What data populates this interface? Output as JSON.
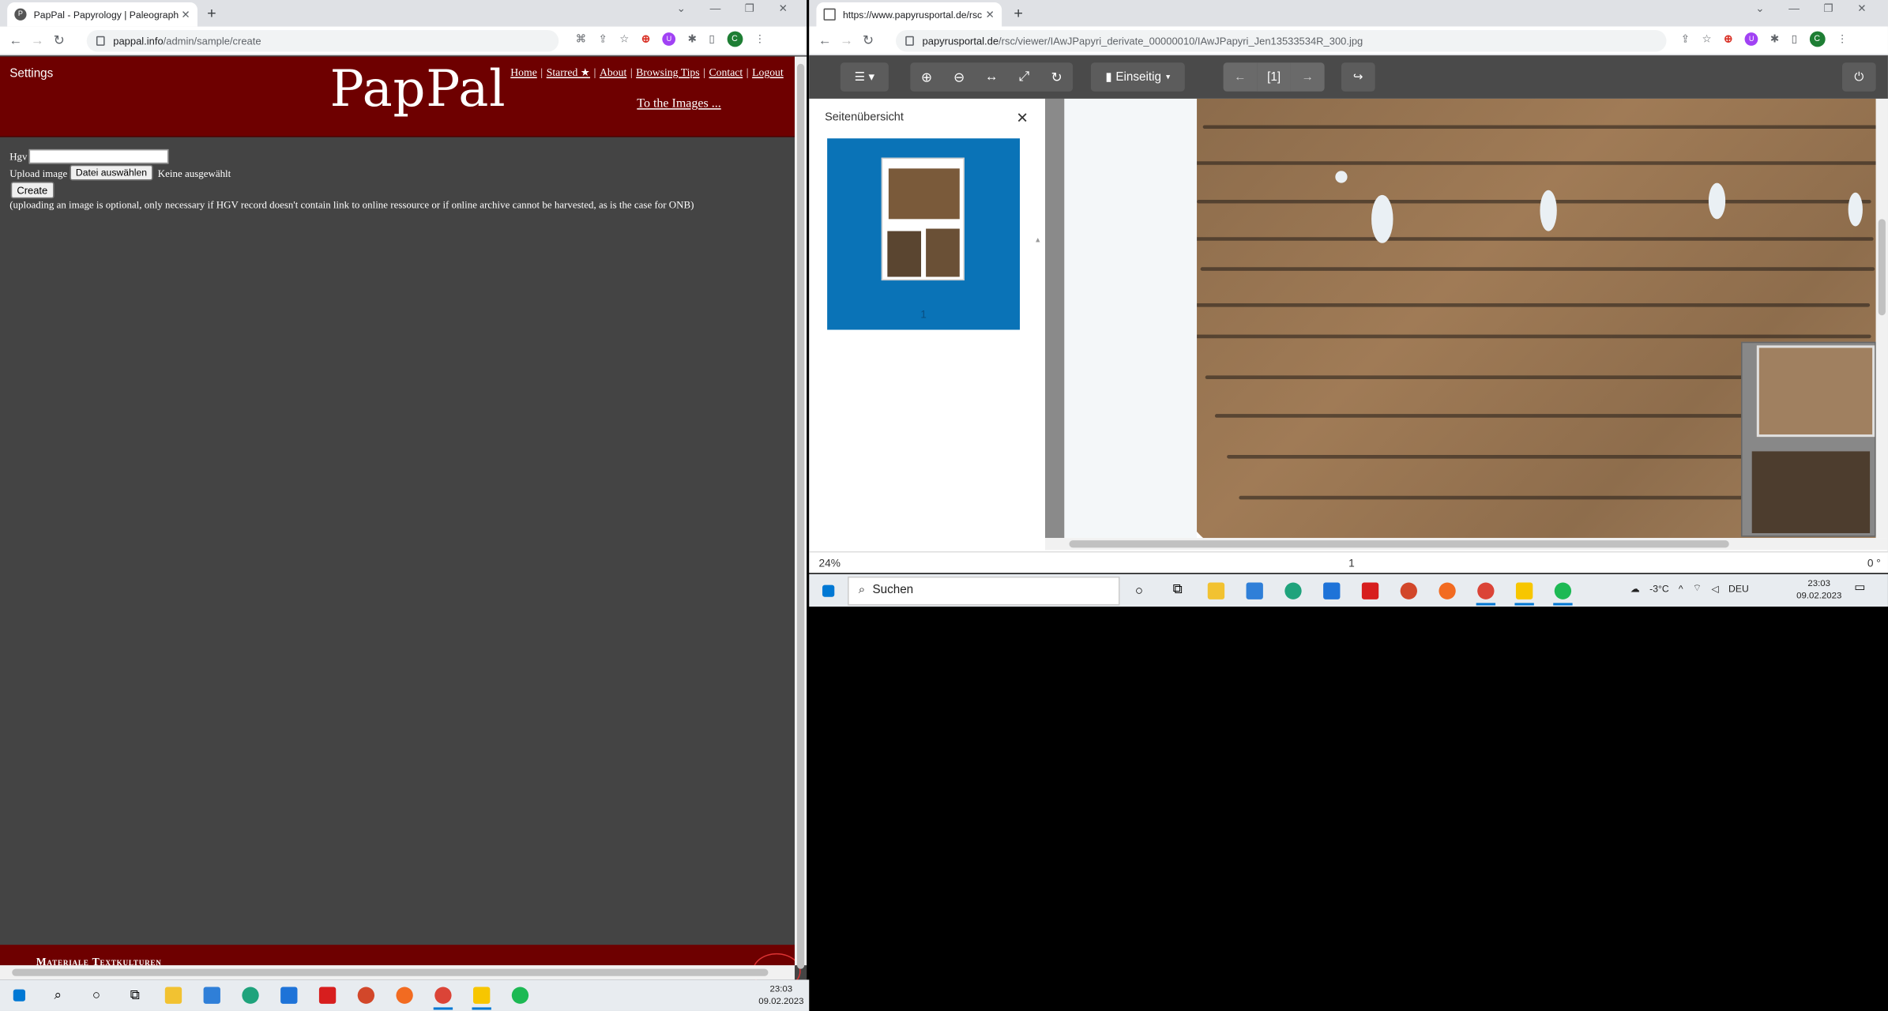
{
  "left_browser": {
    "tab_title": "PapPal - Papyrology | Paleograph",
    "url_host": "pappal.info",
    "url_path": "/admin/sample/create",
    "profile_initial": "C",
    "page": {
      "settings_label": "Settings",
      "logo": "PapPal",
      "nav": [
        "Home",
        "Starred ★",
        "About",
        "Browsing Tips",
        "Contact",
        "Logout"
      ],
      "to_images": "To the Images ...",
      "hgv_label": "Hgv",
      "hgv_value": "",
      "upload_label": "Upload image",
      "file_button": "Datei auswählen",
      "file_status": "Keine ausgewählt",
      "create_button": "Create",
      "hint": "(uploading an image is optional, only necessary if HGV record doesn't contain link to online ressource or if online archive cannot be harvested, as is the case for ONB)",
      "footer_text": "Materiale Textkulturen"
    }
  },
  "right_browser": {
    "tab_title": "https://www.papyrusportal.de/rsc",
    "url_host": "papyrusportal.de",
    "url_path": "/rsc/viewer/IAwJPapyri_derivate_00000010/IAwJPapyri_Jen13533534R_300.jpg",
    "profile_initial": "C",
    "viewer": {
      "layout_button": "Einseitig",
      "page_indicator": "[1]",
      "sidebar_title": "Seitenübersicht",
      "thumbnail_label": "1",
      "zoom": "24%",
      "page_number": "1",
      "rotation": "0 °"
    }
  },
  "taskbar_left": {
    "time": "23:03",
    "date": "09.02.2023"
  },
  "taskbar_right": {
    "search_placeholder": "Suchen",
    "weather": "-3°C",
    "language": "DEU",
    "time": "23:03",
    "date": "09.02.2023"
  }
}
